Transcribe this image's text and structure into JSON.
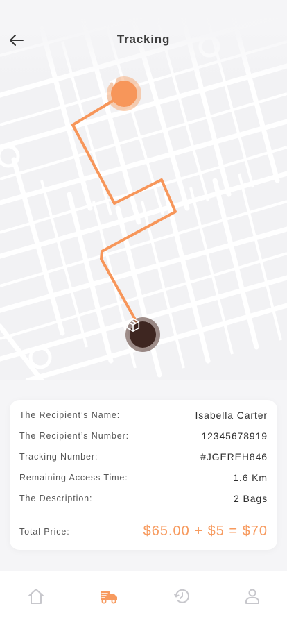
{
  "header": {
    "title": "Tracking"
  },
  "map": {
    "route_color": "#f7965a",
    "origin_marker_icon": "navigation-arrow-icon",
    "destination_marker_icon": "package-box-icon"
  },
  "details": {
    "rows": [
      {
        "label": "The Recipient’s Name:",
        "value": "Isabella Carter"
      },
      {
        "label": "The Recipient’s Number:",
        "value": "12345678919"
      },
      {
        "label": "Tracking Number:",
        "value": "#JGEREH846"
      },
      {
        "label": "Remaining Access Time:",
        "value": "1.6 Km"
      },
      {
        "label": "The Description:",
        "value": "2 Bags"
      }
    ],
    "total_label": "Total Price:",
    "total_value": "$65.00 + $5 = $70"
  },
  "nav": {
    "active_color": "#f79a5e",
    "inactive_color": "#c7c7cc",
    "items": [
      "home-icon",
      "delivery-truck-icon",
      "history-icon",
      "profile-icon"
    ],
    "active": "delivery-truck-icon"
  }
}
